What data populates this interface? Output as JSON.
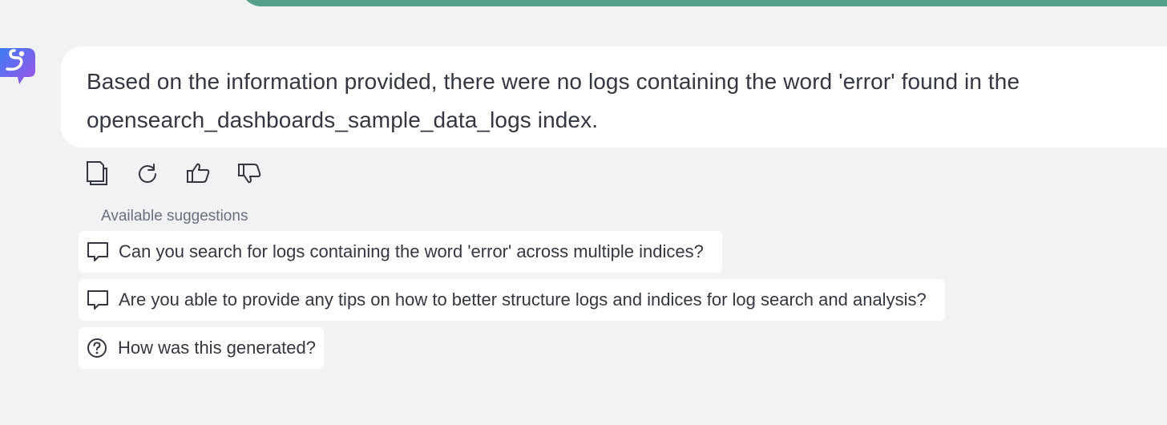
{
  "conversation": {
    "assistant_message": {
      "line1": "Based on the information provided, there were no logs containing the word 'error' found in the",
      "line2": "opensearch_dashboards_sample_data_logs index."
    },
    "actions": [
      {
        "icon": "copy-icon"
      },
      {
        "icon": "regenerate-icon"
      },
      {
        "icon": "thumbs-up-icon"
      },
      {
        "icon": "thumbs-down-icon"
      }
    ],
    "suggestions_title": "Available suggestions",
    "suggestions": [
      {
        "icon": "chat-bubble-icon",
        "label": "Can you search for logs containing the word 'error' across multiple indices?"
      },
      {
        "icon": "chat-bubble-icon",
        "label": "Are you able to provide any tips on how to better structure logs and indices for log search and analysis?"
      },
      {
        "icon": "question-circle-icon",
        "label": "How was this generated?"
      }
    ]
  },
  "colors": {
    "background": "#f1f2f4",
    "user_bubble": "#54a08d",
    "assistant_bubble": "#ffffff",
    "avatar_gradient_start": "#3d7cf5",
    "avatar_gradient_end": "#a052e6",
    "text": "#343741",
    "muted_text": "#69707d"
  }
}
